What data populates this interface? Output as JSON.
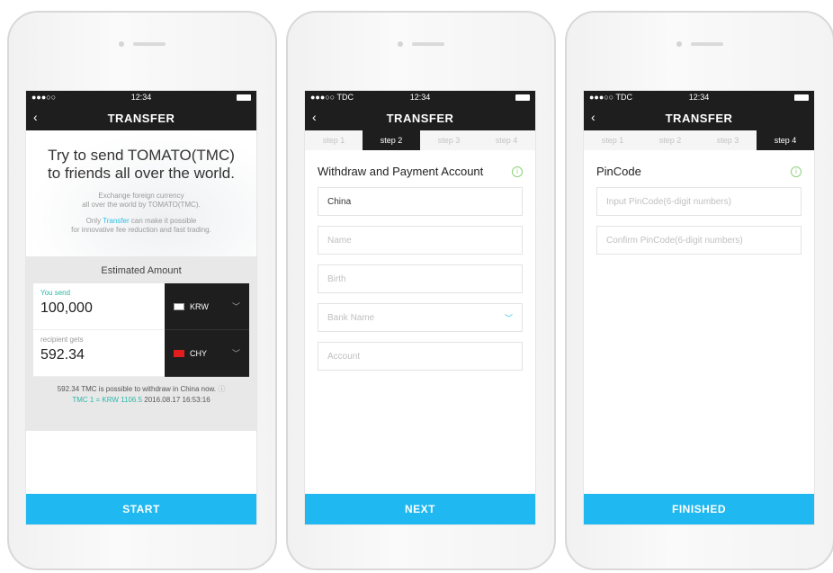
{
  "phone1": {
    "status": {
      "signal": "●●●○○",
      "time": "12:34"
    },
    "nav": {
      "back": "‹",
      "title": "TRANSFER"
    },
    "hero": {
      "title_line1": "Try to send TOMATO(TMC)",
      "title_line2": "to friends all over the world.",
      "desc_line1": "Exchange foreign currency",
      "desc_line2": "all over the world by TOMATO(TMC).",
      "desc2_pre": "Only ",
      "desc2_accent": "Transfer",
      "desc2_post": " can make it possible",
      "desc2_line2": "for innovative fee reduction and fast trading."
    },
    "estimated": {
      "title": "Estimated Amount",
      "send_label": "You send",
      "send_value": "100,000",
      "send_currency": "KRW",
      "recv_label": "recipient gets",
      "recv_value": "592.34",
      "recv_currency": "CHY",
      "note": "592.34 TMC is possible to withdraw in China now.",
      "rate": "TMC 1 = KRW 1106.5",
      "timestamp": "2016.08.17  16:53:16"
    },
    "button": "START"
  },
  "phone2": {
    "status": {
      "signal": "●●●○○ TDC",
      "time": "12:34"
    },
    "nav": {
      "back": "‹",
      "title": "TRANSFER"
    },
    "steps": [
      "step 1",
      "step 2",
      "step 3",
      "step 4"
    ],
    "active_step": 1,
    "form_title": "Withdraw and Payment Account",
    "fields": {
      "country": "China",
      "name": "Name",
      "birth": "Birth",
      "bank": "Bank Name",
      "account": "Account"
    },
    "button": "NEXT"
  },
  "phone3": {
    "status": {
      "signal": "●●●○○ TDC",
      "time": "12:34"
    },
    "nav": {
      "back": "‹",
      "title": "TRANSFER"
    },
    "steps": [
      "step 1",
      "step 2",
      "step 3",
      "step 4"
    ],
    "active_step": 3,
    "form_title": "PinCode",
    "fields": {
      "pin": "Input PinCode(6-digit numbers)",
      "confirm": "Confirm PinCode(6-digit numbers)"
    },
    "button": "FINISHED"
  },
  "colors": {
    "accent": "#1fb8f0",
    "dark": "#1e1e1e",
    "green": "#2ab7a9"
  }
}
